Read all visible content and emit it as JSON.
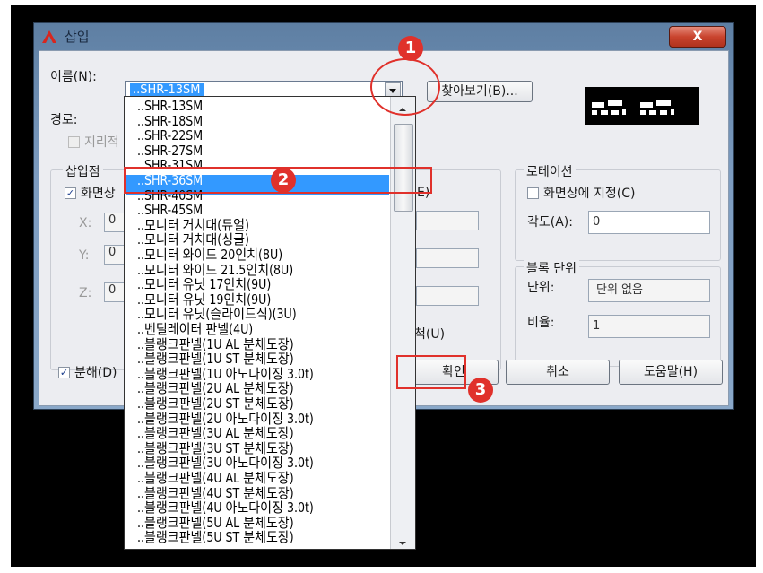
{
  "dialog": {
    "title": "삽입",
    "close_label": "X"
  },
  "name_row": {
    "label": "이름(N):",
    "value": "..SHR-13SM",
    "browse_label": "찾아보기(B)..."
  },
  "path_label": "경로:",
  "geo_checkbox_label": "지리적",
  "insert_point": {
    "group_label": "삽입점",
    "screen_label": "화면상",
    "x_label": "X:",
    "y_label": "Y:",
    "z_label": "Z:",
    "x_value": "0",
    "y_value": "0",
    "z_value": "0"
  },
  "scale_group": {
    "cut_label": "E)",
    "uniform_label": "척(U)"
  },
  "rotation": {
    "group_label": "로테이션",
    "screen_label": "화면상에 지정(C)",
    "angle_label": "각도(A):",
    "angle_value": "0"
  },
  "block_unit": {
    "group_label": "블록 단위",
    "unit_label": "단위:",
    "unit_value": "단위 없음",
    "ratio_label": "비율:",
    "ratio_value": "1"
  },
  "explode_label": "분해(D)",
  "buttons": {
    "ok": "확인",
    "cancel": "취소",
    "help": "도움말(H)"
  },
  "dropdown_items": [
    "..SHR-13SM",
    "..SHR-18SM",
    "..SHR-22SM",
    "..SHR-27SM",
    "..SHR-31SM",
    "..SHR-36SM",
    "..SHR-40SM",
    "..SHR-45SM",
    "..모니터 거치대(듀얼)",
    "..모니터 거치대(싱글)",
    "..모니터 와이드 20인치(8U)",
    "..모니터 와이드 21.5인치(8U)",
    "..모니터 유닛 17인치(9U)",
    "..모니터 유닛 19인치(9U)",
    "..모니터 유닛(슬라이드식)(3U)",
    "..벤틸레이터 판넬(4U)",
    "..블랭크판넬(1U AL 분체도장)",
    "..블랭크판넬(1U ST 분체도장)",
    "..블랭크판넬(1U 아노다이징 3.0t)",
    "..블랭크판넬(2U AL 분체도장)",
    "..블랭크판넬(2U ST 분체도장)",
    "..블랭크판넬(2U 아노다이징 3.0t)",
    "..블랭크판넬(3U AL 분체도장)",
    "..블랭크판넬(3U ST 분체도장)",
    "..블랭크판넬(3U 아노다이징 3.0t)",
    "..블랭크판넬(4U AL 분체도장)",
    "..블랭크판넬(4U ST 분체도장)",
    "..블랭크판넬(4U 아노다이징 3.0t)",
    "..블랭크판넬(5U AL 분체도장)",
    "..블랭크판넬(5U ST 분체도장)"
  ],
  "selected_index": 5,
  "badges": [
    "1",
    "2",
    "3"
  ],
  "colors": {
    "highlight": "#e0312b",
    "selection": "#3399ff",
    "dialog_frame": "#7d9cc0"
  }
}
